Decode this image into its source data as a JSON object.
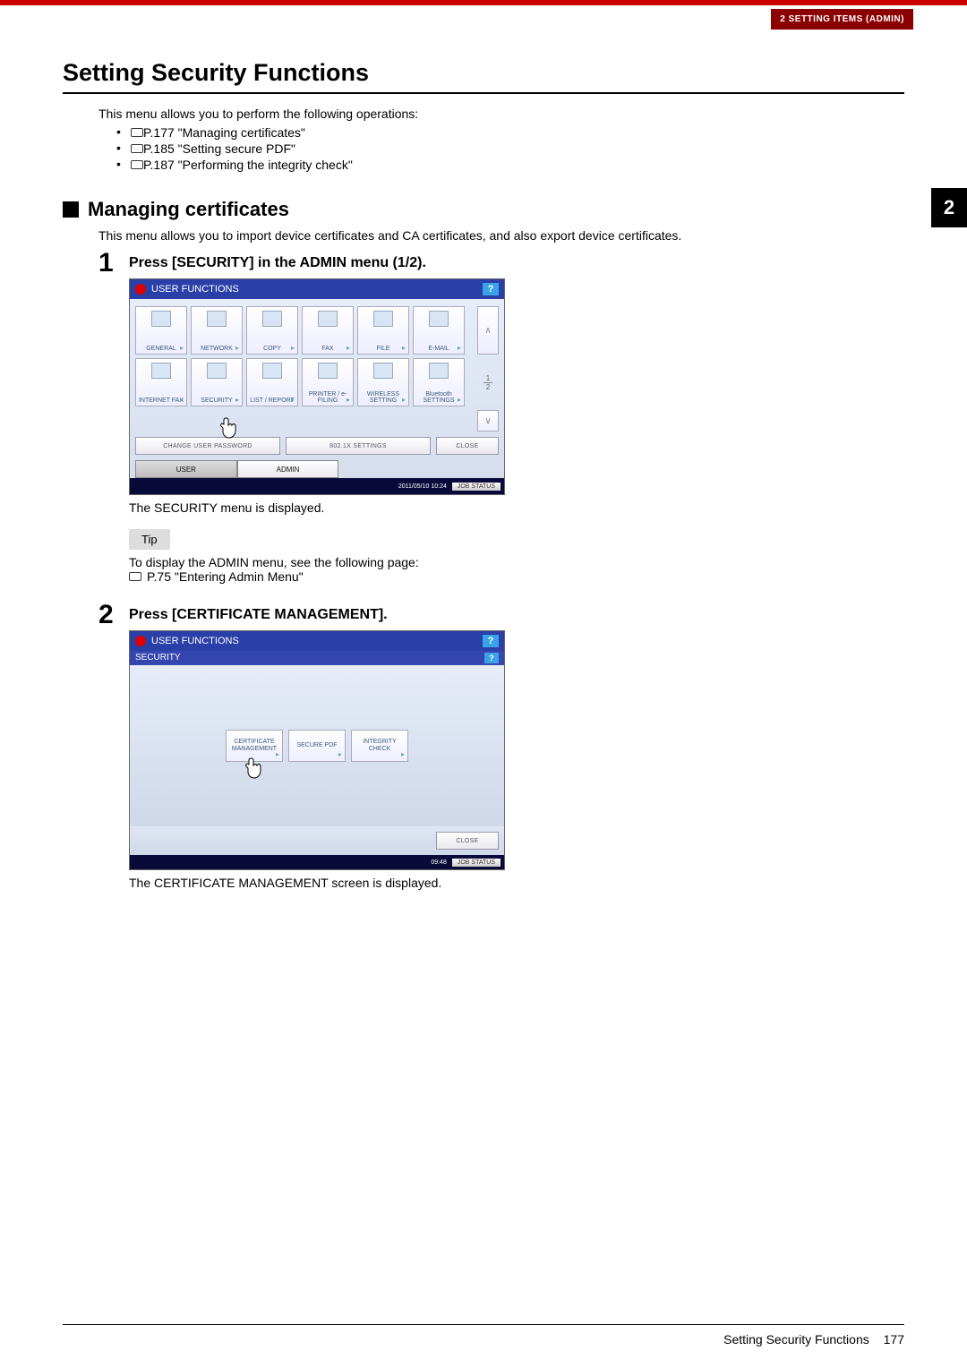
{
  "breadcrumb": "2 SETTING ITEMS (ADMIN)",
  "side_tab": "2",
  "title": "Setting Security Functions",
  "intro": "This menu allows you to perform the following operations:",
  "links": [
    "P.177 \"Managing certificates\"",
    "P.185 \"Setting secure PDF\"",
    "P.187 \"Performing the integrity check\""
  ],
  "section": {
    "heading": "Managing certificates",
    "intro": "This menu allows you to import device certificates and CA certificates, and also export device certificates."
  },
  "steps": [
    {
      "num": "1",
      "title": "Press [SECURITY] in the ADMIN menu (1/2).",
      "result": "The SECURITY menu is displayed.",
      "tip_label": "Tip",
      "tip_text": "To display the ADMIN menu, see the following page:",
      "tip_ref": "P.75 \"Entering Admin Menu\""
    },
    {
      "num": "2",
      "title": "Press [CERTIFICATE MANAGEMENT].",
      "result": "The CERTIFICATE MANAGEMENT screen is displayed."
    }
  ],
  "screenshot1": {
    "window_title": "USER FUNCTIONS",
    "help": "?",
    "cells_row1": [
      "GENERAL",
      "NETWORK",
      "COPY",
      "FAX",
      "FILE",
      "E-MAIL"
    ],
    "cells_row2": [
      "INTERNET FAX",
      "SECURITY",
      "LIST / REPORT",
      "PRINTER / e-FILING",
      "WIRELESS SETTING",
      "Bluetooth SETTINGS"
    ],
    "page_indicator_top": "1",
    "page_indicator_bottom": "2",
    "scroll_up": "∧",
    "scroll_down": "∨",
    "bottom_buttons": [
      "CHANGE USER PASSWORD",
      "802.1X SETTINGS",
      "CLOSE"
    ],
    "tabs": [
      "USER",
      "ADMIN"
    ],
    "active_tab": "ADMIN",
    "timestamp": "2011/05/10 10:24",
    "job_status": "JOB STATUS"
  },
  "screenshot2": {
    "window_title": "USER FUNCTIONS",
    "subtitle": "SECURITY",
    "help": "?",
    "cells": [
      "CERTIFICATE MANAGEMENT",
      "SECURE PDF",
      "INTEGRITY CHECK"
    ],
    "close": "CLOSE",
    "timestamp": "09:48",
    "job_status": "JOB STATUS"
  },
  "footer": {
    "text": "Setting Security Functions",
    "page": "177"
  }
}
